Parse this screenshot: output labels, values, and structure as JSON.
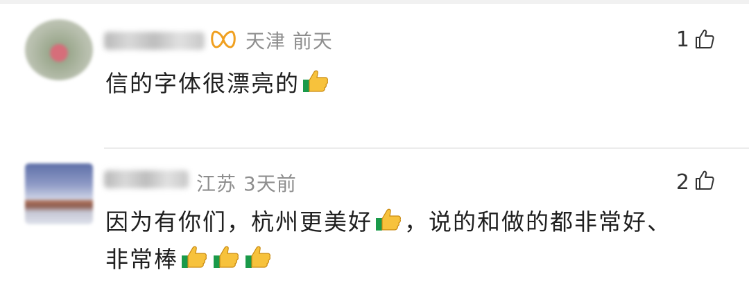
{
  "comments": [
    {
      "username": "",
      "location": "天津",
      "time": "前天",
      "likes": "1",
      "text_before": "信的字体很漂亮的",
      "text_after": "",
      "line2": "",
      "has_vip": true,
      "avatar": "avatar-blurred-photo"
    },
    {
      "username": "",
      "location": "江苏",
      "time": "3天前",
      "likes": "2",
      "text_before": "因为有你们，杭州更美好",
      "text_after": "，说的和做的都非常好、",
      "line2": "非常棒",
      "has_vip": false,
      "avatar": "avatar-blurred-landscape"
    }
  ],
  "icons": {
    "like": "thumbs-up-outline-icon",
    "vip": "vip-badge-icon",
    "emoji": "thumbs-up-emoji"
  },
  "colors": {
    "meta": "#8e8e8e",
    "vip": "#f0a020",
    "emoji_yellow": "#f7c23c",
    "emoji_green": "#1a9a4a"
  }
}
